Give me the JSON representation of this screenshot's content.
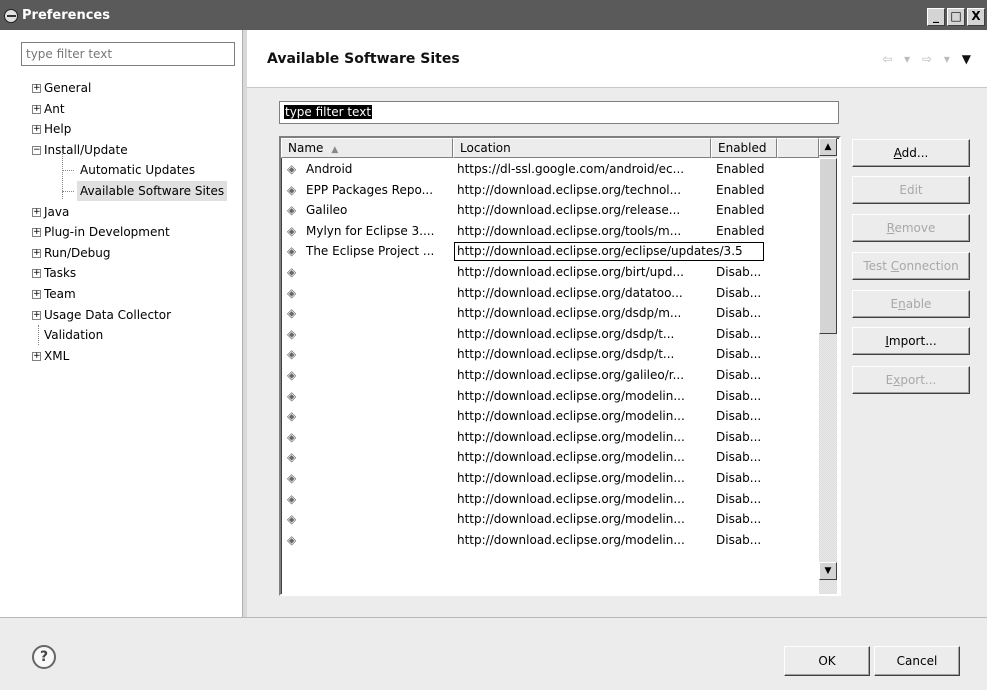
{
  "window": {
    "title": "Preferences",
    "controls": [
      "_",
      "□",
      "X"
    ]
  },
  "left": {
    "filter_placeholder": "type filter text",
    "tree": [
      {
        "label": "General",
        "expander": "+",
        "level": 0
      },
      {
        "label": "Ant",
        "expander": "+",
        "level": 0
      },
      {
        "label": "Help",
        "expander": "+",
        "level": 0
      },
      {
        "label": "Install/Update",
        "expander": "−",
        "level": 0
      },
      {
        "label": "Automatic Updates",
        "expander": "",
        "level": 1
      },
      {
        "label": "Available Software Sites",
        "expander": "",
        "level": 1,
        "selected": true
      },
      {
        "label": "Java",
        "expander": "+",
        "level": 0
      },
      {
        "label": "Plug-in Development",
        "expander": "+",
        "level": 0
      },
      {
        "label": "Run/Debug",
        "expander": "+",
        "level": 0
      },
      {
        "label": "Tasks",
        "expander": "+",
        "level": 0
      },
      {
        "label": "Team",
        "expander": "+",
        "level": 0
      },
      {
        "label": "Usage Data Collector",
        "expander": "+",
        "level": 0
      },
      {
        "label": "Validation",
        "expander": "",
        "level": 0
      },
      {
        "label": "XML",
        "expander": "+",
        "level": 0
      }
    ]
  },
  "main": {
    "title": "Available Software Sites",
    "nav": {
      "back": "⇦ ▾",
      "forward": "⇨ ▾",
      "menu": "▼"
    },
    "filter_value": "type filter text",
    "columns": {
      "name": "Name",
      "location": "Location",
      "enabled": "Enabled",
      "sort_indicator": "▲"
    },
    "rows": [
      {
        "name": "Android",
        "location": "https://dl-ssl.google.com/android/ec...",
        "enabled": "Enabled"
      },
      {
        "name": "EPP Packages Repo...",
        "location": "http://download.eclipse.org/technol...",
        "enabled": "Enabled"
      },
      {
        "name": "Galileo",
        "location": "http://download.eclipse.org/release...",
        "enabled": "Enabled"
      },
      {
        "name": "Mylyn for Eclipse 3....",
        "location": "http://download.eclipse.org/tools/m...",
        "enabled": "Enabled"
      },
      {
        "name": "The Eclipse Project ...",
        "location": "http://download.eclipse.org/eclipse/updates/3.5",
        "enabled": "",
        "editing": true
      },
      {
        "name": "",
        "location": "http://download.eclipse.org/birt/upd...",
        "enabled": "Disab..."
      },
      {
        "name": "",
        "location": "http://download.eclipse.org/datatoo...",
        "enabled": "Disab..."
      },
      {
        "name": "",
        "location": "http://download.eclipse.org/dsdp/m...",
        "enabled": "Disab..."
      },
      {
        "name": "",
        "location": "http://download.eclipse.org/dsdp/t...",
        "enabled": "Disab..."
      },
      {
        "name": "",
        "location": "http://download.eclipse.org/dsdp/t...",
        "enabled": "Disab..."
      },
      {
        "name": "",
        "location": "http://download.eclipse.org/galileo/r...",
        "enabled": "Disab..."
      },
      {
        "name": "",
        "location": "http://download.eclipse.org/modelin...",
        "enabled": "Disab..."
      },
      {
        "name": "",
        "location": "http://download.eclipse.org/modelin...",
        "enabled": "Disab..."
      },
      {
        "name": "",
        "location": "http://download.eclipse.org/modelin...",
        "enabled": "Disab..."
      },
      {
        "name": "",
        "location": "http://download.eclipse.org/modelin...",
        "enabled": "Disab..."
      },
      {
        "name": "",
        "location": "http://download.eclipse.org/modelin...",
        "enabled": "Disab..."
      },
      {
        "name": "",
        "location": "http://download.eclipse.org/modelin...",
        "enabled": "Disab..."
      },
      {
        "name": "",
        "location": "http://download.eclipse.org/modelin...",
        "enabled": "Disab..."
      },
      {
        "name": "",
        "location": "http://download.eclipse.org/modelin...",
        "enabled": "Disab..."
      }
    ],
    "buttons": [
      {
        "label": "Add...",
        "mnemonic": "A",
        "enabled": true
      },
      {
        "label": "Edit",
        "mnemonic": "",
        "enabled": false
      },
      {
        "label": "Remove",
        "mnemonic": "R",
        "enabled": false
      },
      {
        "label": "Test Connection",
        "mnemonic": "C",
        "enabled": false
      },
      {
        "label": "Enable",
        "mnemonic": "n",
        "enabled": false
      },
      {
        "label": "Import...",
        "mnemonic": "I",
        "enabled": true
      },
      {
        "label": "Export...",
        "mnemonic": "x",
        "enabled": false
      }
    ]
  },
  "footer": {
    "help": "?",
    "ok": "OK",
    "cancel": "Cancel"
  },
  "icons": {
    "row_icon": "update-site-icon",
    "app_icon": "eclipse-icon"
  }
}
